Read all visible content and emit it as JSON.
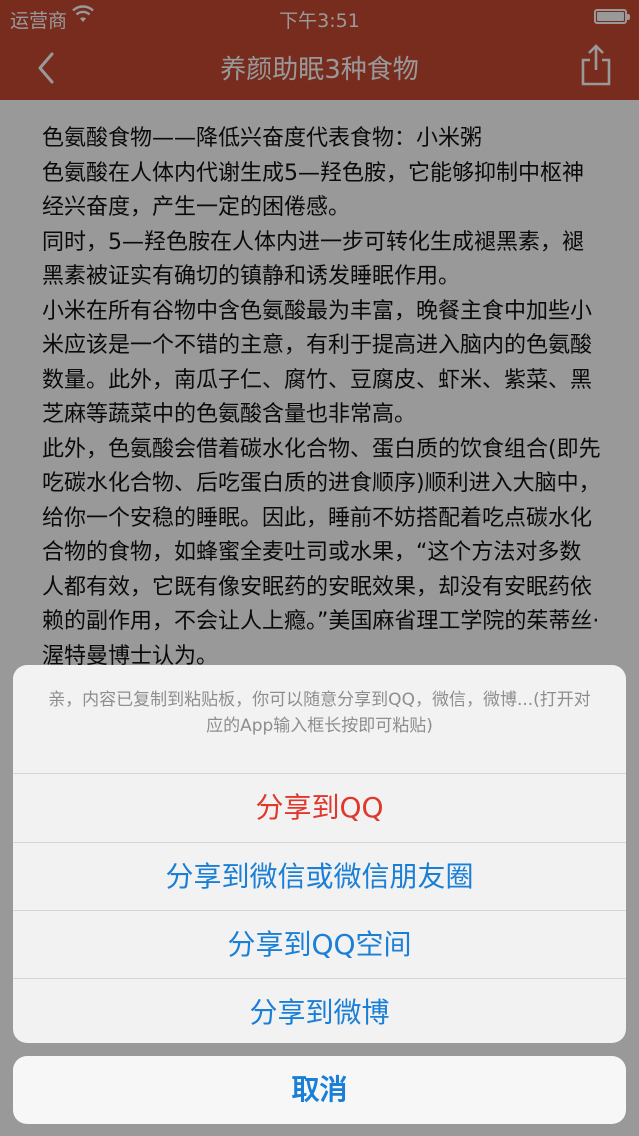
{
  "status_bar": {
    "carrier": "运营商",
    "time": "下午3:51"
  },
  "nav": {
    "title": "养颜助眠3种食物",
    "back_icon": "chevron-left-icon",
    "share_icon": "share-icon"
  },
  "article": {
    "paragraphs": [
      "色氨酸食物——降低兴奋度代表食物：小米粥",
      "色氨酸在人体内代谢生成5—羟色胺，它能够抑制中枢神经兴奋度，产生一定的困倦感。",
      "同时，5—羟色胺在人体内进一步可转化生成褪黑素，褪黑素被证实有确切的镇静和诱发睡眠作用。",
      "小米在所有谷物中含色氨酸最为丰富，晚餐主食中加些小米应该是一个不错的主意，有利于提高进入脑内的色氨酸数量。此外，南瓜子仁、腐竹、豆腐皮、虾米、紫菜、黑芝麻等蔬菜中的色氨酸含量也非常高。",
      "此外，色氨酸会借着碳水化合物、蛋白质的饮食组合(即先吃碳水化合物、后吃蛋白质的进食顺序)顺利进入大脑中，给你一个安稳的睡眠。因此，睡前不妨搭配着吃点碳水化合物的食物，如蜂蜜全麦吐司或水果，“这个方法对多数人都有效，它既有像安眠药的安眠效果，却没有安眠药依赖的副作用，不会让人上瘾。”美国麻省理工学院的茱蒂丝·渥特曼博士认为。"
    ]
  },
  "action_sheet": {
    "message": "亲，内容已复制到粘贴板，你可以随意分享到QQ，微信，微博...(打开对应的App输入框长按即可粘贴)",
    "options": [
      "分享到QQ",
      "分享到微信或微信朋友圈",
      "分享到QQ空间",
      "分享到微博"
    ],
    "cancel": "取消"
  },
  "colors": {
    "nav_red": "#c84a33",
    "destructive_red": "#e0382c",
    "action_blue": "#1a7fd6"
  }
}
